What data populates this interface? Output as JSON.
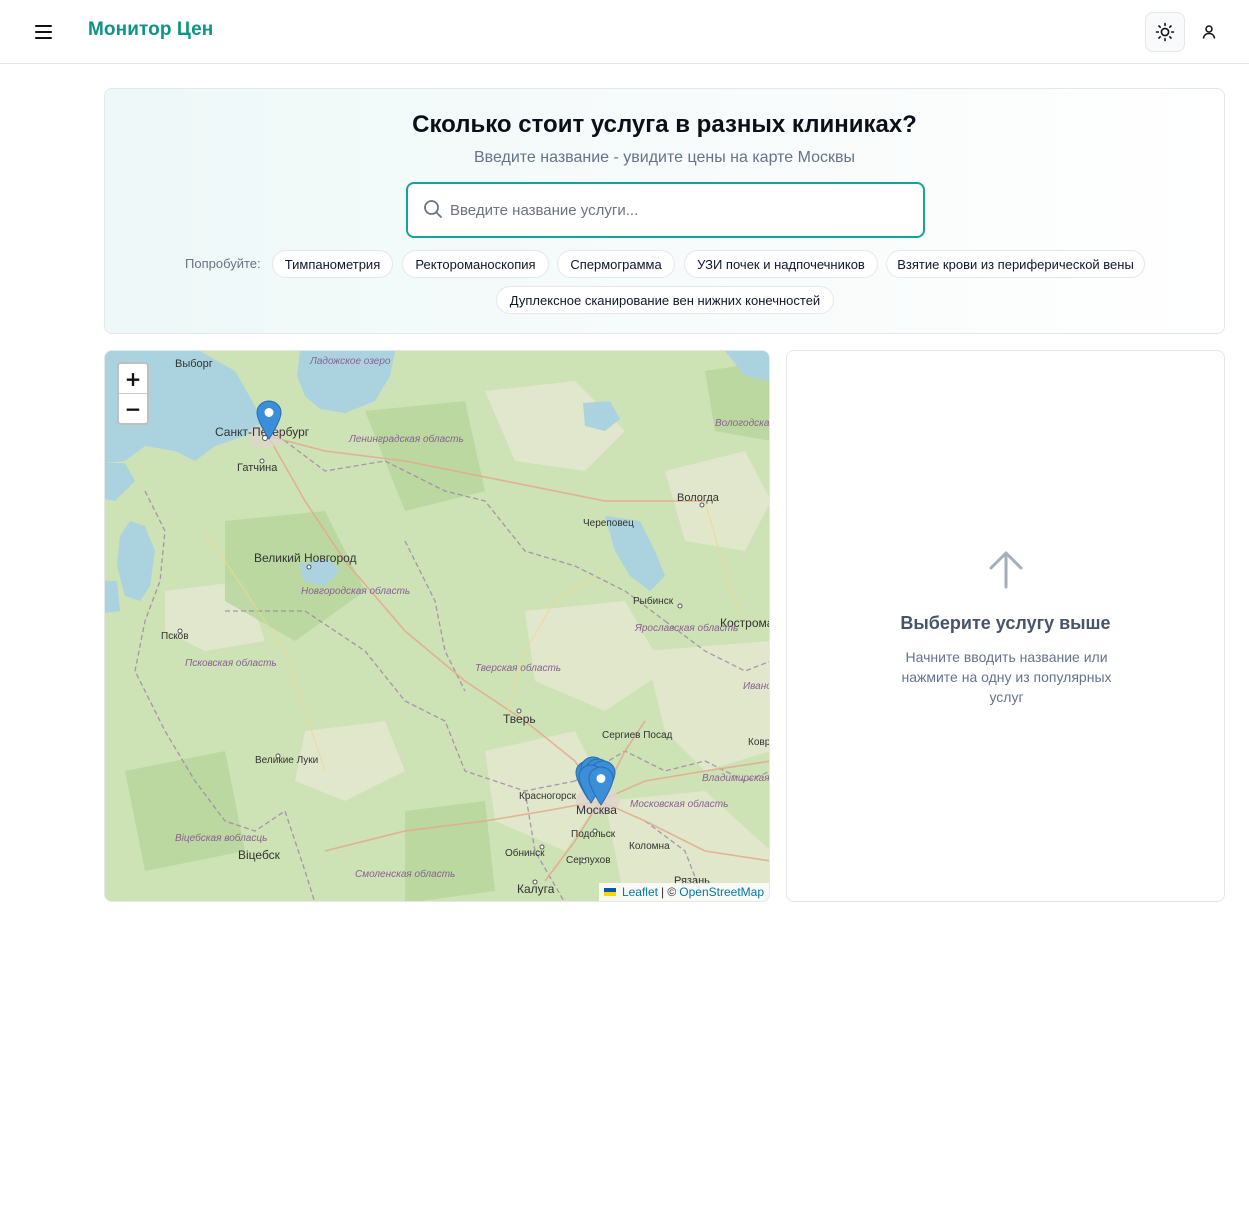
{
  "header": {
    "brand": "Монитор Цен",
    "icons": {
      "menu": "menu-icon",
      "theme": "sun-icon",
      "user": "user-icon"
    }
  },
  "hero": {
    "title": "Сколько стоит услуга в разных клиниках?",
    "subtitle": "Введите название - увидите цены на карте Москвы",
    "search": {
      "placeholder": "Введите название услуги...",
      "value": ""
    },
    "try_label": "Попробуйте:",
    "chips": [
      "Тимпанометрия",
      "Ректороманоскопия",
      "Спермограмма",
      "УЗИ почек и надпочечников",
      "Взятие крови из периферической вены",
      "Дуплексное сканирование вен нижних конечностей"
    ]
  },
  "map": {
    "zoom_in": "+",
    "zoom_out": "−",
    "attribution": {
      "leaflet": "Leaflet",
      "separator": "| ©",
      "osm": "OpenStreetMap"
    },
    "places": [
      "Выборг",
      "Санкт-Петербург",
      "Гатчина",
      "Ленинградская область",
      "Ладожское озеро",
      "Вологда",
      "Вологодская область",
      "Череповец",
      "Великий Новгород",
      "Новгородская область",
      "Рыбинск",
      "Ярославская область",
      "Кострома",
      "Псков",
      "Псковская область",
      "Тверская область",
      "Тверь",
      "Сергиев Посад",
      "Великие Луки",
      "Красногорск",
      "Москва",
      "Московская область",
      "Владимирская область",
      "Подольск",
      "Коломна",
      "Обнинск",
      "Серпухов",
      "Віцебск",
      "Віцебская вобласць",
      "Смоленская область",
      "Калуга",
      "Рязань",
      "Ивановская область",
      "Ковров"
    ]
  },
  "panel": {
    "title": "Выберите услугу выше",
    "text": "Начните вводить название или нажмите на одну из популярных услуг"
  }
}
